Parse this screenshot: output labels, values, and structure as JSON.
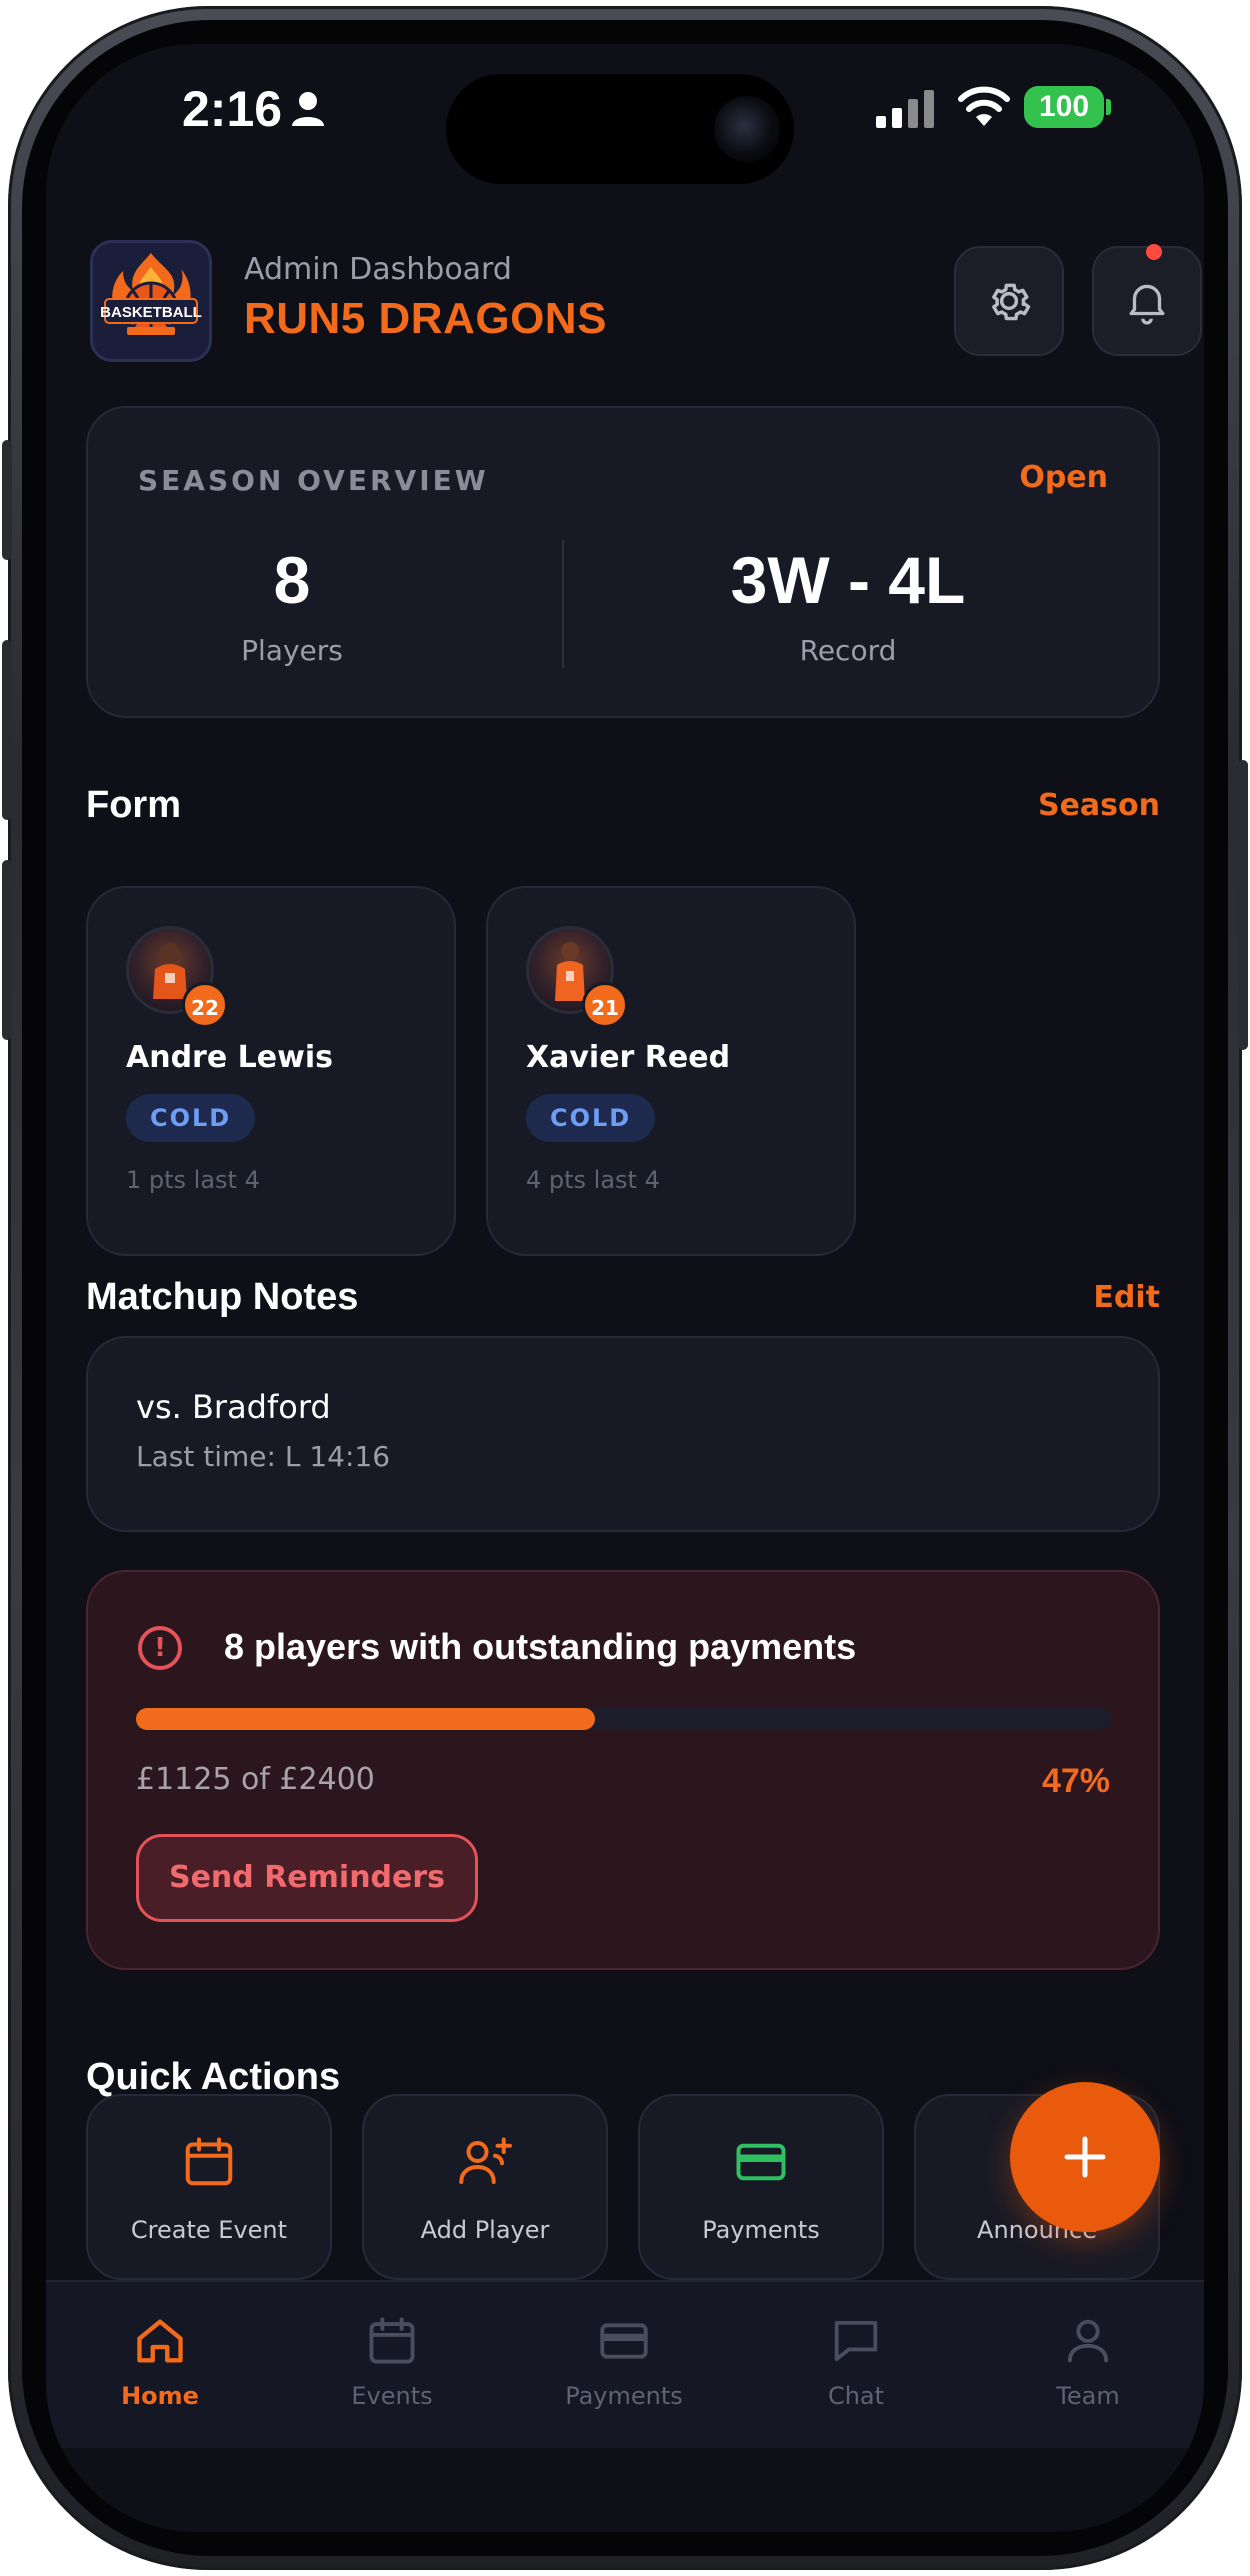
{
  "status_bar": {
    "time": "2:16",
    "battery": "100"
  },
  "header": {
    "subtitle": "Admin Dashboard",
    "team_name": "RUN5 DRAGONS",
    "logo_text": "BASKETBALL"
  },
  "season_overview": {
    "label": "SEASON OVERVIEW",
    "open_label": "Open",
    "players_value": "8",
    "players_caption": "Players",
    "record_value": "3W - 4L",
    "record_caption": "Record"
  },
  "form": {
    "title": "Form",
    "link": "Season",
    "players": [
      {
        "name": "Andre Lewis",
        "number": "22",
        "status": "COLD",
        "meta": "1 pts last 4"
      },
      {
        "name": "Xavier Reed",
        "number": "21",
        "status": "COLD",
        "meta": "4 pts last 4"
      }
    ]
  },
  "matchup_notes": {
    "title": "Matchup Notes",
    "link": "Edit",
    "opponent": "vs. Bradford",
    "last_time": "Last time: L 14:16"
  },
  "payments_alert": {
    "title": "8 players with outstanding payments",
    "amount": "£1125 of £2400",
    "percent": "47%",
    "progress_fraction": 0.47,
    "button": "Send Reminders"
  },
  "quick_actions": {
    "title": "Quick Actions",
    "items": [
      {
        "label": "Create Event",
        "icon": "calendar-icon"
      },
      {
        "label": "Add Player",
        "icon": "user-plus-icon"
      },
      {
        "label": "Payments",
        "icon": "card-icon"
      },
      {
        "label": "Announce",
        "icon": "megaphone-icon"
      }
    ]
  },
  "tabbar": {
    "items": [
      {
        "label": "Home",
        "icon": "home-icon"
      },
      {
        "label": "Events",
        "icon": "calendar-icon"
      },
      {
        "label": "Payments",
        "icon": "card-icon"
      },
      {
        "label": "Chat",
        "icon": "chat-icon"
      },
      {
        "label": "Team",
        "icon": "person-icon"
      }
    ]
  },
  "colors": {
    "accent": "#f26a1b",
    "background": "#0e0f17",
    "card": "#171925",
    "cold_badge": "#6f9cf5",
    "alert": "#e2535a"
  }
}
